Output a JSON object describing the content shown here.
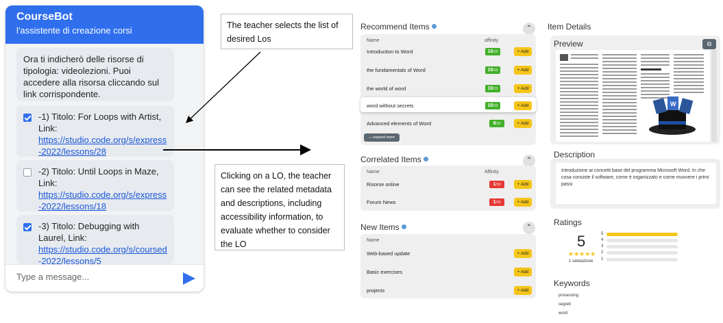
{
  "chat": {
    "title": "CourseBot",
    "subtitle": "l'assistente di creazione corsi",
    "intro": "Ora ti indicherò delle risorse di tipologia: videolezioni. Puoi accedere alla risorsa cliccando sul link corrispondente.",
    "items": [
      {
        "title": "-1) Titolo: For Loops with Artist, Link:",
        "link": "https://studio.code.org/s/express-2022/lessons/28",
        "checked": true
      },
      {
        "title": "-2) Titolo: Until Loops in Maze, Link:",
        "link": "https://studio.code.org/s/express-2022/lessons/18",
        "checked": false
      },
      {
        "title": "-3) Titolo: Debugging with Laurel, Link:",
        "link": "https://studio.code.org/s/coursed-2022/lessons/5",
        "checked": true
      }
    ],
    "input_placeholder": "Type a message..."
  },
  "annotations": {
    "note1": "The teacher selects the list of desired Los",
    "note2": "Clicking on a LO, the teacher can see the related metadata and descriptions, including accessibility information, to evaluate whether to consider the LO"
  },
  "recommend": {
    "title": "Recommend Items",
    "col_name": "Name",
    "col_affinity": "affinity",
    "add_label": "+ Add",
    "expand_label": "⌄ expand more",
    "rows": [
      {
        "name": "Introduction to Word",
        "score": "10",
        "max": "/10"
      },
      {
        "name": "the fundamentals of Word",
        "score": "10",
        "max": "/10"
      },
      {
        "name": "the world of word",
        "score": "10",
        "max": "/10"
      },
      {
        "name": "word without secrets",
        "score": "10",
        "max": "/10"
      },
      {
        "name": "Advanced elements of Word",
        "score": "8",
        "max": "/10"
      }
    ]
  },
  "correlated": {
    "title": "Correlated Items",
    "col_name": "Name",
    "col_affinity": "Affinity",
    "add_label": "+ Add",
    "rows": [
      {
        "name": "Risorse online",
        "score": "1",
        "max": "/10"
      },
      {
        "name": "Forum News",
        "score": "1",
        "max": "/10"
      }
    ]
  },
  "new_items": {
    "title": "New Items",
    "col_name": "Name",
    "add_label": "+ Add",
    "rows": [
      {
        "name": "Web-based update"
      },
      {
        "name": "Basic exercises"
      },
      {
        "name": "projects"
      }
    ]
  },
  "details": {
    "title": "Item Details",
    "preview_title": "Preview",
    "description_title": "Description",
    "description": "Introduzione ai concetti base del programma Microsoft Word. In che cosa consiste il software, come è organizzato e come muovere i primi passi",
    "ratings_title": "Ratings",
    "average": "5",
    "stars": "★★★★★",
    "votes": "1 valutazione",
    "distribution": [
      {
        "star": "5",
        "fraction": 1.0
      },
      {
        "star": "4",
        "fraction": 0.0
      },
      {
        "star": "3",
        "fraction": 0.0
      },
      {
        "star": "2",
        "fraction": 0.0
      },
      {
        "star": "1",
        "fraction": 0.0
      }
    ],
    "keywords_title": "Keywords",
    "keywords": [
      "processing",
      "segreti",
      "word"
    ]
  },
  "colors": {
    "accent": "#2f6fed",
    "score_high": "#43b02a",
    "score_low": "#e53935",
    "add_button": "#f5c518"
  },
  "icons": {
    "send": "send-icon",
    "info": "info-icon",
    "collapse": "chevron-up-icon",
    "open_external": "open-external-icon",
    "star": "star-icon"
  }
}
